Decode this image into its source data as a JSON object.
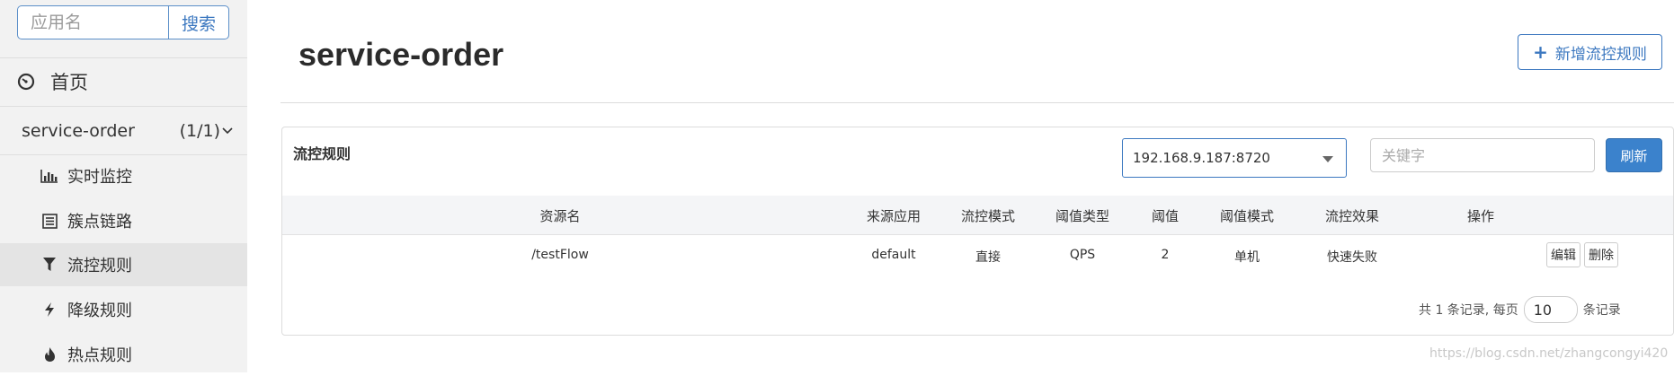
{
  "sidebar": {
    "search": {
      "placeholder": "应用名",
      "value": "",
      "button_label": "搜索"
    },
    "home_label": "首页",
    "app": {
      "name": "service-order",
      "count": "(1/1)"
    },
    "items": [
      {
        "label": "实时监控",
        "icon": "bar-chart-icon"
      },
      {
        "label": "簇点链路",
        "icon": "list-icon"
      },
      {
        "label": "流控规则",
        "icon": "filter-icon",
        "active": true
      },
      {
        "label": "降级规则",
        "icon": "flash-icon"
      },
      {
        "label": "热点规则",
        "icon": "fire-icon"
      }
    ]
  },
  "main": {
    "title": "service-order",
    "add_button": "新增流控规则",
    "panel": {
      "title": "流控规则",
      "machine_select": "192.168.9.187:8720",
      "keyword_placeholder": "关键字",
      "refresh_label": "刷新",
      "columns": [
        "资源名",
        "来源应用",
        "流控模式",
        "阈值类型",
        "阈值",
        "阈值模式",
        "流控效果",
        "操作"
      ],
      "rows": [
        {
          "resource": "/testFlow",
          "origin": "default",
          "mode": "直接",
          "threshold_type": "QPS",
          "threshold": "2",
          "threshold_mode": "单机",
          "effect": "快速失败",
          "edit": "编辑",
          "delete": "删除"
        }
      ],
      "pagination": {
        "prefix": "共 1 条记录, 每页",
        "page_size": "10",
        "suffix": "条记录"
      }
    }
  },
  "watermark": "https://blog.csdn.net/zhangcongyi420",
  "colors": {
    "accent": "#3c78c0",
    "primary_button": "#3b82cc",
    "sidebar_bg": "#f2f2f2"
  }
}
